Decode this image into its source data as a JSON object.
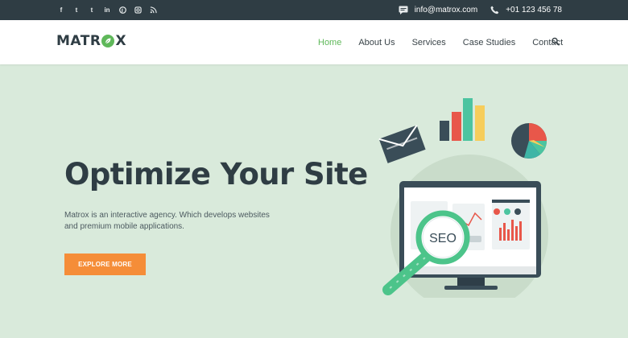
{
  "topbar": {
    "social_icons": [
      "facebook-icon",
      "twitter-icon",
      "tumblr-icon",
      "linkedin-icon",
      "pinterest-icon",
      "instagram-icon",
      "rss-icon"
    ],
    "social_glyphs": [
      "f",
      "t",
      "t",
      "in",
      "p",
      "o",
      "rss"
    ],
    "email": "info@matrox.com",
    "phone": "+01 123 456 78"
  },
  "nav": {
    "logo_left": "MATR",
    "logo_right": "X",
    "items": [
      {
        "label": "Home",
        "active": true
      },
      {
        "label": "About Us",
        "active": false
      },
      {
        "label": "Services",
        "active": false
      },
      {
        "label": "Case Studies",
        "active": false
      },
      {
        "label": "Contact",
        "active": false
      }
    ]
  },
  "hero": {
    "title": "Optimize Your Site",
    "text": "Matrox is an interactive agency. Which develops websites and premium mobile applications.",
    "button_label": "EXPLORE MORE",
    "illustration_label": "SEO"
  },
  "colors": {
    "accent": "#5fb85a",
    "button": "#f58d38",
    "topbar": "#2f3d44",
    "hero_bg": "#d9eadb",
    "heading": "#2f3d44"
  }
}
